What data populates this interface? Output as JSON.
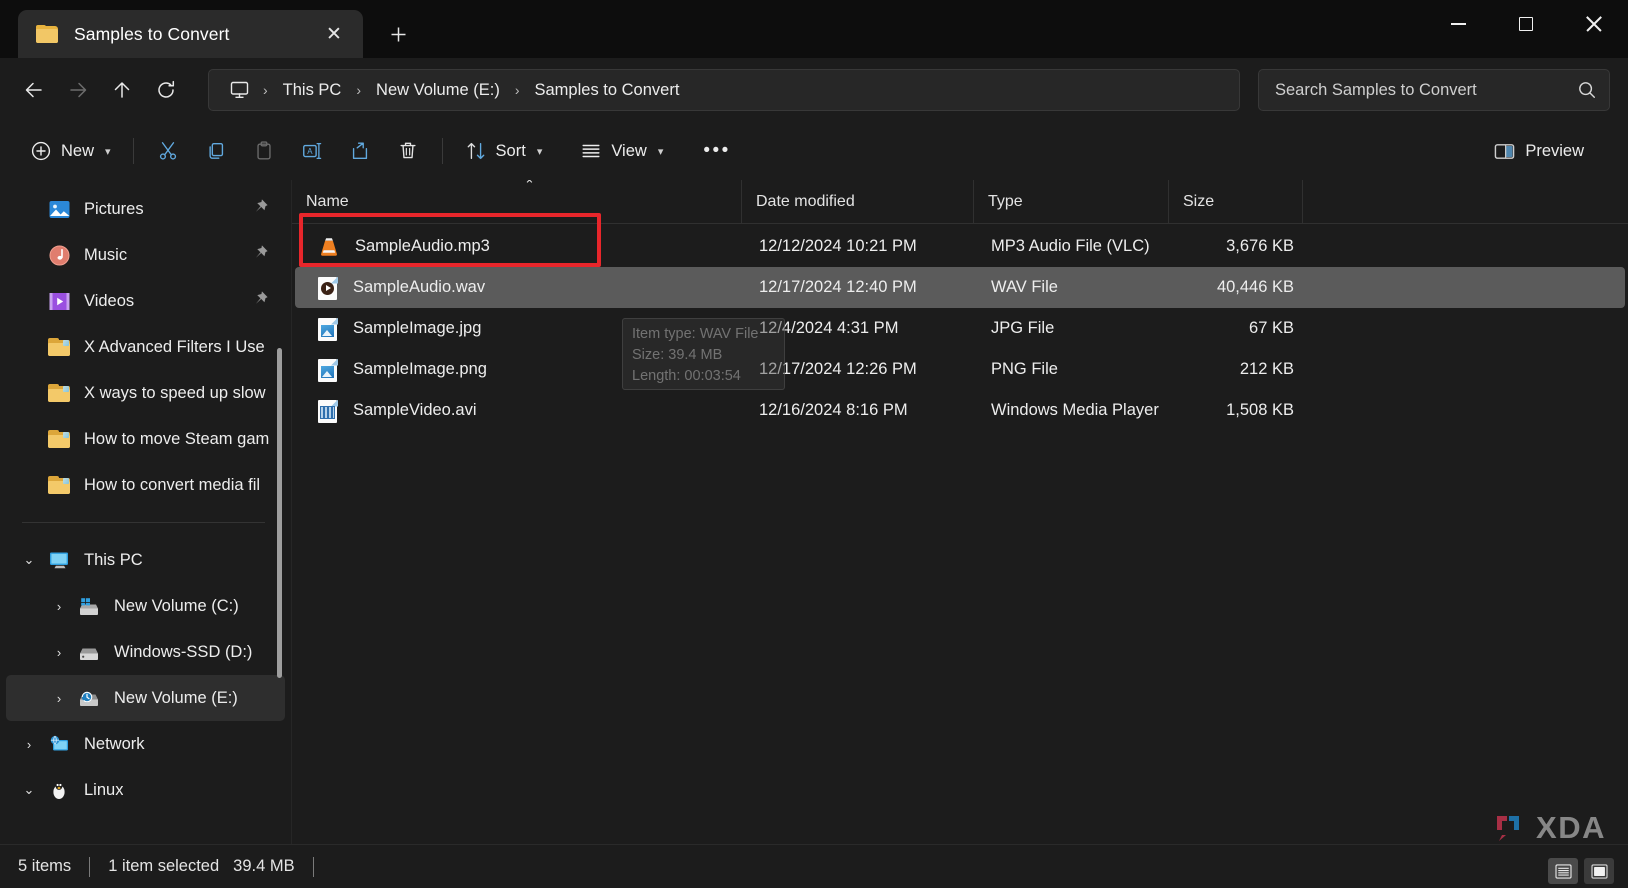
{
  "window": {
    "tab_title": "Samples to Convert",
    "tab_close_label": "✕",
    "new_tab_label": "＋",
    "minimize_label": "Minimize",
    "maximize_label": "Maximize",
    "close_label": "Close"
  },
  "address": {
    "back_label": "Back",
    "forward_label": "Forward",
    "up_label": "Up",
    "refresh_label": "Refresh",
    "breadcrumb": [
      {
        "label": "This PC",
        "icon": "monitor-icon"
      },
      {
        "label": "New Volume (E:)",
        "icon": ""
      },
      {
        "label": "Samples to Convert",
        "icon": ""
      }
    ],
    "separator": "›"
  },
  "search": {
    "placeholder": "Search Samples to Convert",
    "value": "",
    "icon": "search-icon"
  },
  "toolbar": {
    "new_label": "New",
    "cut_label": "Cut",
    "copy_label": "Copy",
    "paste_label": "Paste",
    "rename_label": "Rename",
    "share_label": "Share",
    "delete_label": "Delete",
    "sort_label": "Sort",
    "view_label": "View",
    "more_label": "•••",
    "preview_label": "Preview",
    "chevron": "⌵"
  },
  "sidebar": {
    "items": [
      {
        "label": "Pictures",
        "icon": "pictures-icon",
        "pinned": true,
        "chevron": "",
        "selected": false
      },
      {
        "label": "Music",
        "icon": "music-icon",
        "pinned": true,
        "chevron": "",
        "selected": false
      },
      {
        "label": "Videos",
        "icon": "videos-icon",
        "pinned": true,
        "chevron": "",
        "selected": false
      },
      {
        "label": "X Advanced Filters I Use",
        "icon": "folder-icon",
        "pinned": false,
        "chevron": "",
        "selected": false
      },
      {
        "label": "X ways to speed up slow",
        "icon": "folder-icon",
        "pinned": false,
        "chevron": "",
        "selected": false
      },
      {
        "label": "How to move Steam gam",
        "icon": "folder-icon",
        "pinned": false,
        "chevron": "",
        "selected": false
      },
      {
        "label": "How to convert media fil",
        "icon": "folder-icon",
        "pinned": false,
        "chevron": "",
        "selected": false
      }
    ],
    "tree": [
      {
        "label": "This PC",
        "icon": "thispc-icon",
        "chevron": "⌄",
        "indent": 0,
        "selected": false
      },
      {
        "label": "New Volume (C:)",
        "icon": "windrive-icon",
        "chevron": "›",
        "indent": 1,
        "selected": false
      },
      {
        "label": "Windows-SSD (D:)",
        "icon": "drive-icon",
        "chevron": "›",
        "indent": 1,
        "selected": false
      },
      {
        "label": "New Volume (E:)",
        "icon": "histdrive-icon",
        "chevron": "›",
        "indent": 1,
        "selected": true
      },
      {
        "label": "Network",
        "icon": "network-icon",
        "chevron": "›",
        "indent": 0,
        "selected": false
      },
      {
        "label": "Linux",
        "icon": "linux-icon",
        "chevron": "⌄",
        "indent": 0,
        "selected": false
      }
    ]
  },
  "filelist": {
    "columns": [
      {
        "key": "name",
        "label": "Name"
      },
      {
        "key": "date",
        "label": "Date modified"
      },
      {
        "key": "type",
        "label": "Type"
      },
      {
        "key": "size",
        "label": "Size"
      }
    ],
    "sort_column": "Name",
    "sort_caret": "⌃",
    "rows": [
      {
        "name": "SampleAudio.mp3",
        "date": "12/12/2024 10:21 PM",
        "type": "MP3 Audio File (VLC)",
        "size": "3,676 KB",
        "icon": "vlc-cone-icon",
        "selected": false
      },
      {
        "name": "SampleAudio.wav",
        "date": "12/17/2024 12:40 PM",
        "type": "WAV File",
        "size": "40,446 KB",
        "icon": "wav-file-icon",
        "selected": true
      },
      {
        "name": "SampleImage.jpg",
        "date": "12/4/2024 4:31 PM",
        "type": "JPG File",
        "size": "67 KB",
        "icon": "image-file-icon",
        "selected": false
      },
      {
        "name": "SampleImage.png",
        "date": "12/17/2024 12:26 PM",
        "type": "PNG File",
        "size": "212 KB",
        "icon": "image-file-icon",
        "selected": false
      },
      {
        "name": "SampleVideo.avi",
        "date": "12/16/2024 8:16 PM",
        "type": "Windows Media Player",
        "size": "1,508 KB",
        "icon": "video-file-icon",
        "selected": false
      }
    ]
  },
  "tooltip": {
    "line1": "Item type: WAV File",
    "line2": "Size: 39.4 MB",
    "line3": "Length: 00:03:54"
  },
  "statusbar": {
    "item_count": "5 items",
    "selection": "1 item selected",
    "selection_size": "39.4 MB",
    "details_view_label": "Details view",
    "icons_view_label": "Large icons view"
  },
  "watermark": {
    "text": "XDA"
  },
  "colors": {
    "accent": "#4cc2ff",
    "annotation": "#e8262b",
    "selection": "#5b5b5b",
    "background": "#1c1c1c"
  }
}
